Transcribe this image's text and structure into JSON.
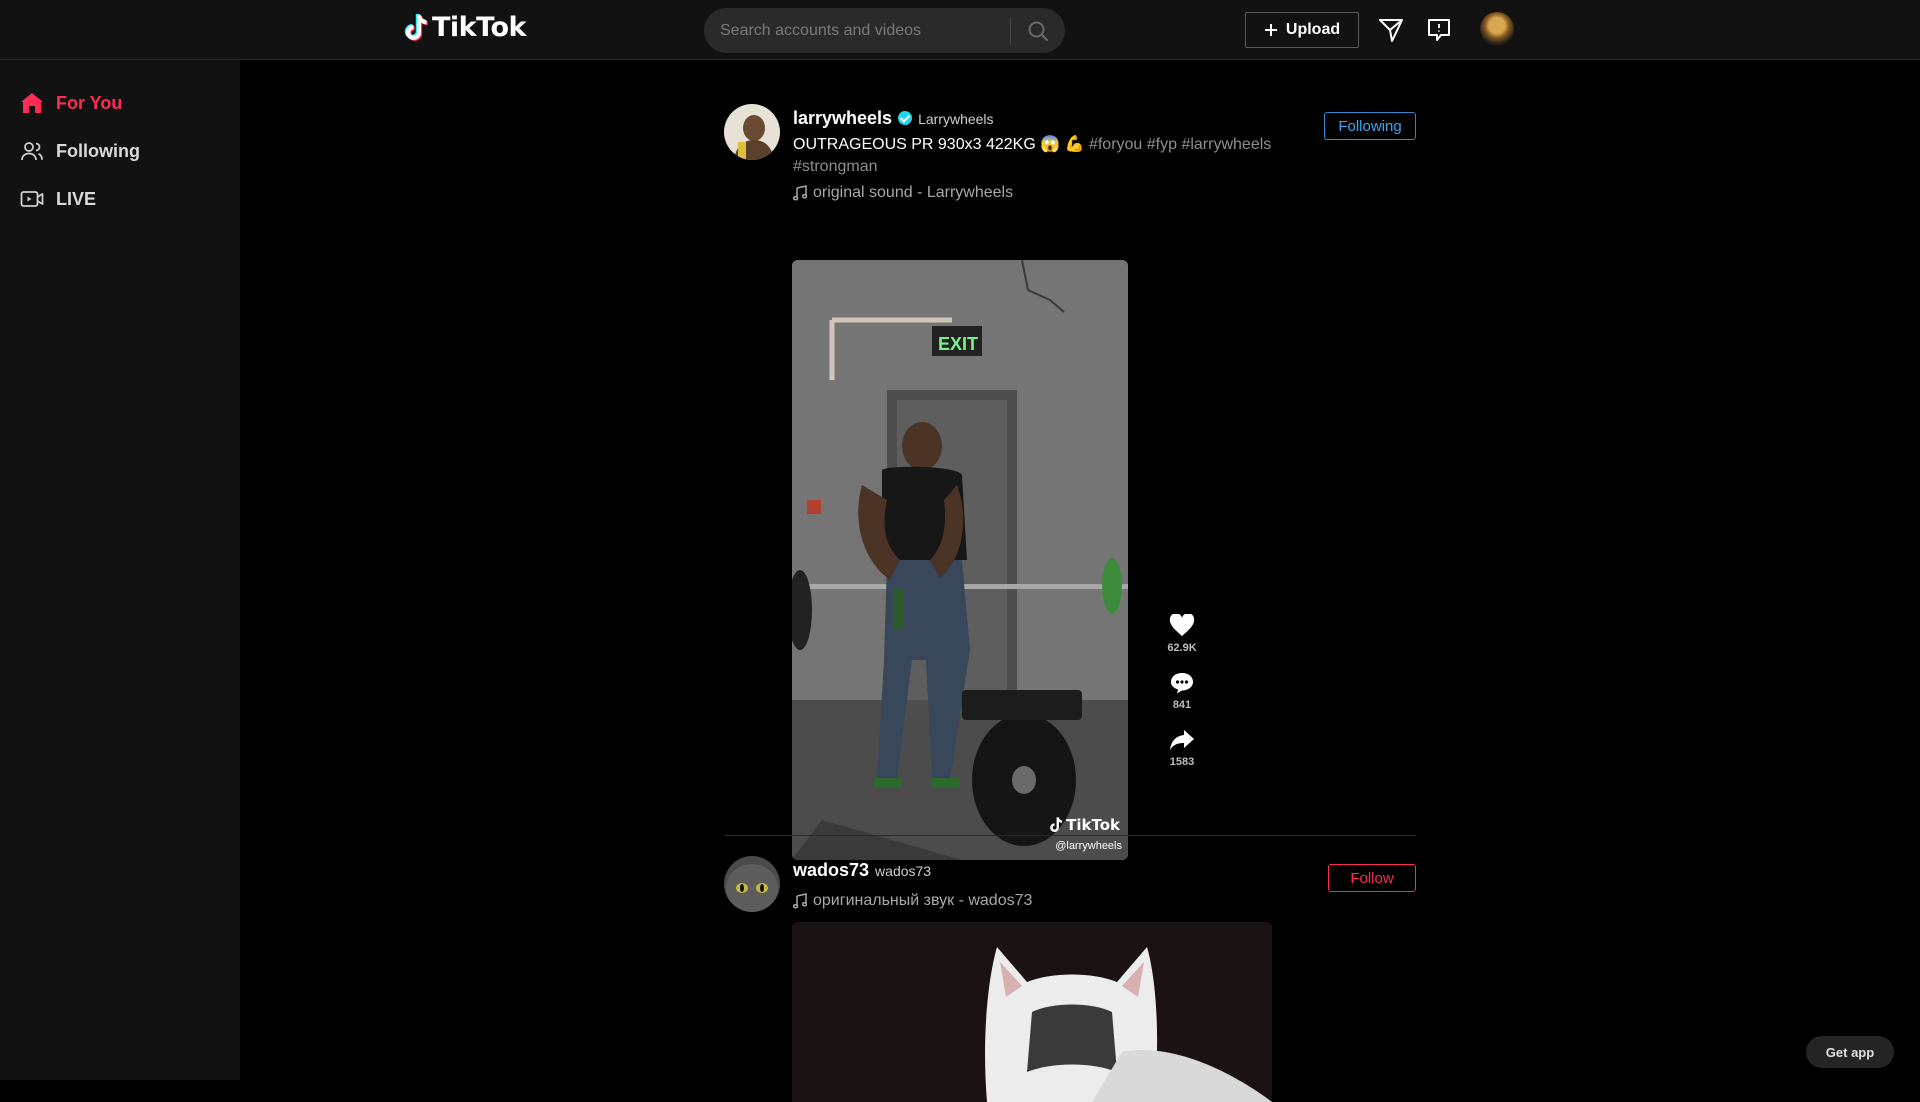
{
  "header": {
    "logo_text": "TikTok",
    "search_placeholder": "Search accounts and videos",
    "upload_label": "Upload"
  },
  "sidebar": {
    "items": [
      {
        "label": "For You",
        "icon": "home-icon",
        "active": true
      },
      {
        "label": "Following",
        "icon": "users-icon",
        "active": false
      },
      {
        "label": "LIVE",
        "icon": "live-camera-icon",
        "active": false
      }
    ]
  },
  "feed": {
    "posts": [
      {
        "author": "larrywheels",
        "nickname": "Larrywheels",
        "verified": true,
        "caption_text": "OUTRAGEOUS PR 930x3 422KG 😱 💪",
        "hashtags": "#foryou #fyp #larrywheels #strongman",
        "music": "original sound - Larrywheels",
        "follow_label": "Following",
        "watermark_logo": "TikTok",
        "watermark_handle": "@larrywheels",
        "video_sign": "EXIT",
        "likes": "62.9K",
        "comments": "841",
        "shares": "1583"
      },
      {
        "author": "wados73",
        "nickname": "wados73",
        "verified": false,
        "music": "оригинальный звук - wados73",
        "follow_label": "Follow"
      }
    ]
  },
  "get_app_label": "Get app",
  "colors": {
    "accent": "#fe2c55",
    "following_blue": "#3da4f0",
    "header_bg": "#121212",
    "page_bg": "#000000"
  }
}
